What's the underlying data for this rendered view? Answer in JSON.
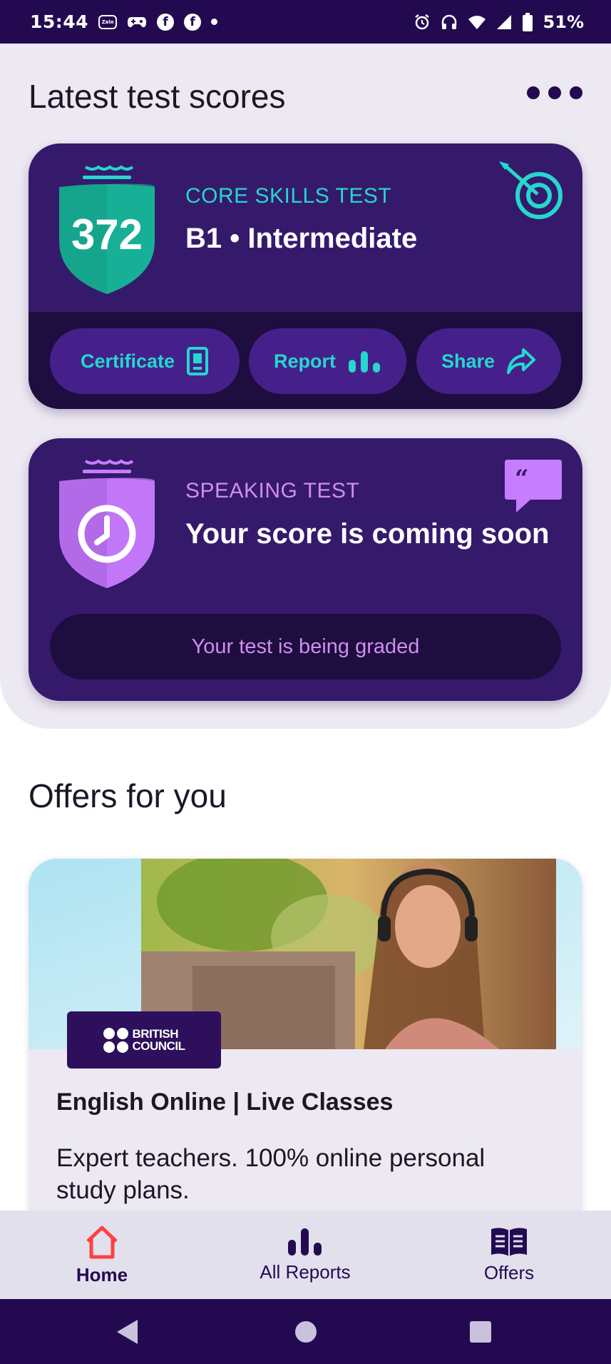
{
  "status_bar": {
    "time": "15:44",
    "zalo_label": "Zalo",
    "facebook_glyph": "f",
    "battery": "51%"
  },
  "scores": {
    "title": "Latest test scores",
    "core": {
      "score": "372",
      "kind": "CORE SKILLS TEST",
      "level": "B1 • Intermediate",
      "buttons": {
        "certificate": "Certificate",
        "report": "Report",
        "share": "Share"
      }
    },
    "speaking": {
      "kind": "SPEAKING TEST",
      "headline": "Your score is coming soon",
      "status": "Your test is being graded"
    }
  },
  "offers": {
    "title": "Offers for you",
    "card": {
      "logo_line1": "BRITISH",
      "logo_line2": "COUNCIL",
      "title": "English Online | Live Classes",
      "description": "Expert teachers. 100% online personal study plans."
    }
  },
  "bottom_nav": {
    "home": "Home",
    "all_reports": "All Reports",
    "offers": "Offers"
  },
  "colors": {
    "brand_dark": "#230a50",
    "card_purple": "#351a6b",
    "teal": "#25d7cd",
    "speaking_accent": "#c77dff",
    "home_accent": "#ff4040"
  },
  "icons": {
    "target": "target-icon",
    "quote": "quote-bubble-icon",
    "certificate": "certificate-icon",
    "report": "bar-chart-icon",
    "share": "share-arrow-icon",
    "home": "home-icon",
    "reports": "bar-chart-icon",
    "offers": "book-icon"
  }
}
